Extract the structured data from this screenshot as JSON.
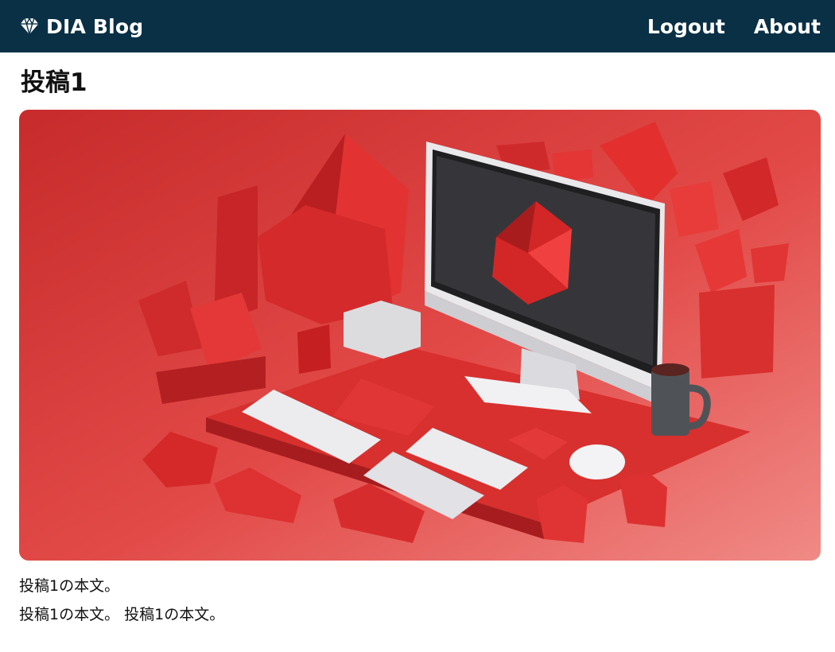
{
  "header": {
    "brand": {
      "name": "DIA Blog",
      "icon": "diamond-icon"
    },
    "nav": [
      {
        "label": "Logout"
      },
      {
        "label": "About"
      }
    ],
    "colors": {
      "background": "#0a3045",
      "text": "#ffffff"
    }
  },
  "post": {
    "title": "投稿1",
    "image": {
      "subject": "red low-poly isometric computer desk illustration"
    },
    "body": [
      "投稿1の本文。",
      "投稿1の本文。 投稿1の本文。"
    ]
  }
}
